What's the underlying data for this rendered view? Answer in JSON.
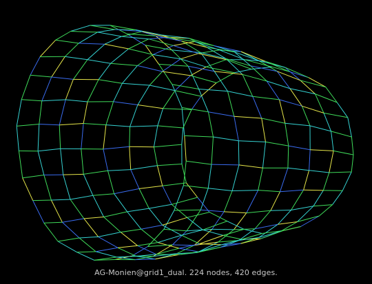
{
  "caption": "AG-Monien@grid1_dual. 224 nodes, 420 edges.",
  "graph": {
    "name": "AG-Monien@grid1_dual",
    "nodes": 224,
    "edges": 420
  },
  "colors": {
    "background": "#000000",
    "caption": "#c8c8c8",
    "edge_yellow": "#e6e64a",
    "edge_green": "#3fdc5a",
    "edge_cyan": "#35d2d2",
    "edge_blue": "#3a6cf0"
  }
}
